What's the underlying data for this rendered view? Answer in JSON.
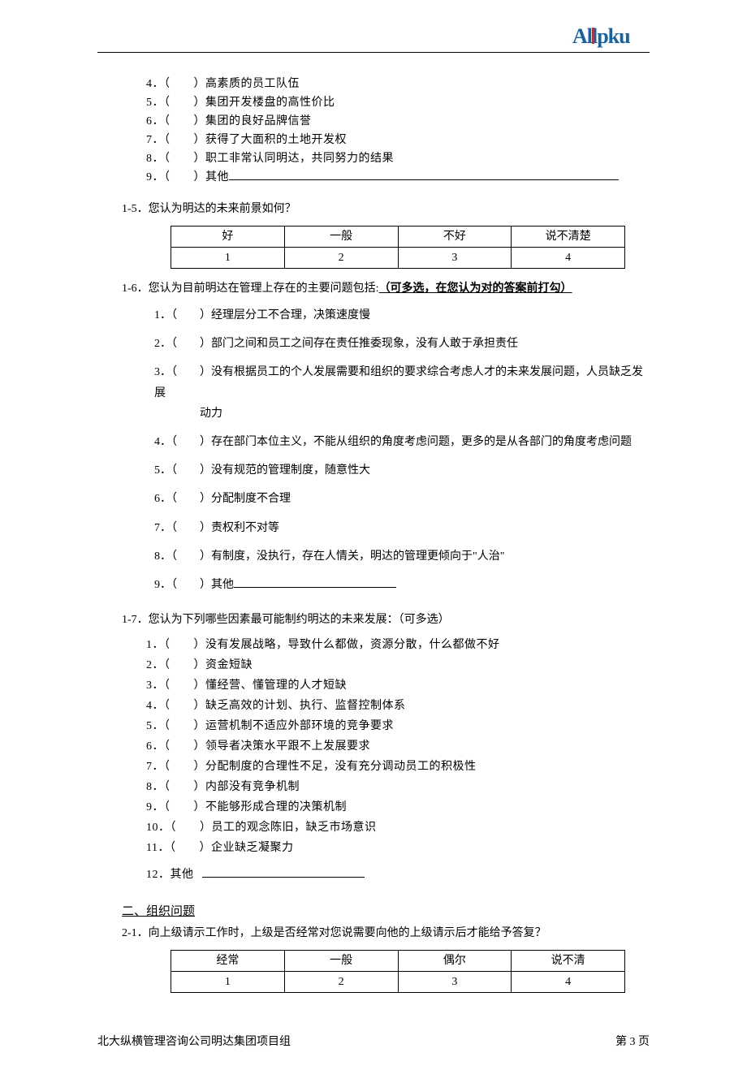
{
  "logo_text": "Allpku",
  "q14": {
    "items": [
      {
        "num": "4．",
        "text": "高素质的员工队伍"
      },
      {
        "num": "5．",
        "text": "集团开发楼盘的高性价比"
      },
      {
        "num": "6．",
        "text": "集团的良好品牌信誉"
      },
      {
        "num": "7．",
        "text": "获得了大面积的土地开发权"
      },
      {
        "num": "8．",
        "text": "职工非常认同明达，共同努力的结果"
      },
      {
        "num": "9．",
        "text": "其他"
      }
    ]
  },
  "q15": {
    "title": "1-5．您认为明达的未来前景如何？",
    "headers": [
      "好",
      "一般",
      "不好",
      "说不清楚"
    ],
    "values": [
      "1",
      "2",
      "3",
      "4"
    ]
  },
  "q16": {
    "title_pre": "1-6．您认为目前明达在管理上存在的主要问题包括:",
    "title_instr": "（可多选，在您认为对的答案前打勾）",
    "items": [
      {
        "num": "1．",
        "text": "经理层分工不合理，决策速度慢"
      },
      {
        "num": "2．",
        "text": "部门之间和员工之间存在责任推委现象，没有人敢于承担责任"
      },
      {
        "num": "3．",
        "text": "没有根据员工的个人发展需要和组织的要求综合考虑人才的未来发展问题，人员缺乏发展",
        "cont": "动力"
      },
      {
        "num": "4．",
        "text": "存在部门本位主义，不能从组织的角度考虑问题，更多的是从各部门的角度考虑问题"
      },
      {
        "num": "5．",
        "text": "没有规范的管理制度，随意性大"
      },
      {
        "num": "6．",
        "text": "分配制度不合理"
      },
      {
        "num": "7．",
        "text": "责权利不对等"
      },
      {
        "num": "8．",
        "text": "有制度，没执行，存在人情关，明达的管理更倾向于\"人治\""
      },
      {
        "num": "9．",
        "text": "其他",
        "blank": true
      }
    ]
  },
  "q17": {
    "title": "1-7．您认为下列哪些因素最可能制约明达的未来发展：（可多选）",
    "items": [
      {
        "num": "1．",
        "text": "没有发展战略，导致什么都做，资源分散，什么都做不好"
      },
      {
        "num": "2．",
        "text": "资金短缺"
      },
      {
        "num": "3．",
        "text": "懂经营、懂管理的人才短缺"
      },
      {
        "num": "4．",
        "text": "缺乏高效的计划、执行、监督控制体系"
      },
      {
        "num": "5．",
        "text": "运营机制不适应外部环境的竞争要求"
      },
      {
        "num": "6．",
        "text": "领导者决策水平跟不上发展要求"
      },
      {
        "num": "7．",
        "text": "分配制度的合理性不足，没有充分调动员工的积极性"
      },
      {
        "num": "8．",
        "text": "内部没有竞争机制"
      },
      {
        "num": "9．",
        "text": "不能够形成合理的决策机制"
      },
      {
        "num": "10．",
        "text": "员工的观念陈旧，缺乏市场意识"
      },
      {
        "num": "11．",
        "text": "企业缺乏凝聚力"
      }
    ],
    "item12": {
      "num": "12．",
      "label": "其他"
    }
  },
  "section2": {
    "title": "二、组织问题",
    "q21": {
      "title": "2-1．向上级请示工作时，上级是否经常对您说需要向他的上级请示后才能给予答复？",
      "headers": [
        "经常",
        "一般",
        "偶尔",
        "说不清"
      ],
      "values": [
        "1",
        "2",
        "3",
        "4"
      ]
    }
  },
  "footer": {
    "left": "北大纵横管理咨询公司明达集团项目组",
    "right": "第 3 页"
  }
}
